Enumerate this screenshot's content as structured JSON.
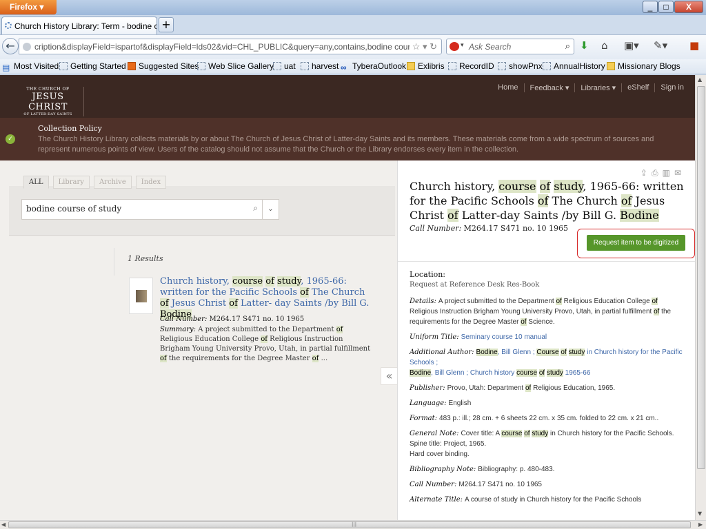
{
  "browser": {
    "app_button": "Firefox",
    "tab_title": "Church History Library: Term - bodine co...",
    "new_tab": "+",
    "url": "cription&displayField=ispartof&displayField=lds02&vid=CHL_PUBLIC&query=any,contains,bodine course of st",
    "search_placeholder": "Ask Search",
    "bookmarks": [
      {
        "label": "Most Visited",
        "icon": "bookmarks-sidebar-icon"
      },
      {
        "label": "Getting Started",
        "icon": "page-icon"
      },
      {
        "label": "Suggested Sites",
        "icon": "orange-icon"
      },
      {
        "label": "Web Slice Gallery",
        "icon": "page-icon"
      },
      {
        "label": "uat",
        "icon": "page-icon"
      },
      {
        "label": "harvest",
        "icon": "page-icon"
      },
      {
        "label": "TyberaOutlook",
        "icon": "blue-icon"
      },
      {
        "label": "Exlibris",
        "icon": "folder-icon"
      },
      {
        "label": "RecordID",
        "icon": "page-icon"
      },
      {
        "label": "showPnx",
        "icon": "page-icon"
      },
      {
        "label": "AnnualHistory",
        "icon": "page-icon"
      },
      {
        "label": "Missionary Blogs",
        "icon": "folder-icon"
      }
    ]
  },
  "site": {
    "logo": {
      "top": "THE CHURCH OF",
      "mid": "JESUS CHRIST",
      "bot": "OF LATTER-DAY SAINTS"
    },
    "nav": [
      "Home",
      "Feedback ▾",
      "Libraries ▾",
      "eShelf",
      "Sign in"
    ],
    "policy": {
      "title": "Collection Policy",
      "text": "The Church History Library collects materials by or about The Church of Jesus Christ of Latter-day Saints and its members. These materials come from a wide spectrum of sources and represent numerous points of view. Users of the catalog should not assume that the Church or the Library endorses every item in the collection."
    },
    "filter_tabs": [
      "ALL",
      "Library",
      "Archive",
      "Index"
    ],
    "query": "bodine course of study",
    "results_count": "1 Results",
    "result": {
      "call_label": "Call Number:",
      "call_value": "M264.17 S471 no. 10 1965",
      "summary_label": "Summary:"
    },
    "detail": {
      "call_label": "Call Number:",
      "call_value": "M264.17 S471 no. 10 1965",
      "request_button": "Request item to be digitized",
      "location_label": "Location:",
      "location_value": "Request at Reference Desk Res-Book",
      "uniform_title_label": "Uniform Title:",
      "uniform_title_value": "Seminary course 10 manual",
      "additional_author_label": "Additional Author:",
      "publisher_label": "Publisher:",
      "publisher_value_a": "Provo, Utah: Department ",
      "publisher_value_b": " Religious Education, 1965.",
      "language_label": "Language:",
      "language_value": "English",
      "format_label": "Format:",
      "format_value": "483 p.: ill.; 28 cm. + 6 sheets 22 cm. x 35 cm. folded to 22 cm. x 21 cm..",
      "general_note_label": "General Note:",
      "bibliography_label": "Bibliography Note:",
      "bibliography_value": "Bibliography: p. 480-483.",
      "call_number2_label": "Call Number:",
      "call_number2_value": "M264.17 S471 no. 10 1965",
      "alternate_title_label": "Alternate Title:",
      "alternate_title_value": "A course of study in Church history for the Pacific Schools"
    }
  },
  "colors": {
    "header": "#3b2822",
    "policy": "#4f3129",
    "link": "#3d67a8",
    "highlight": "#dde5c6",
    "request": "#56962a"
  }
}
